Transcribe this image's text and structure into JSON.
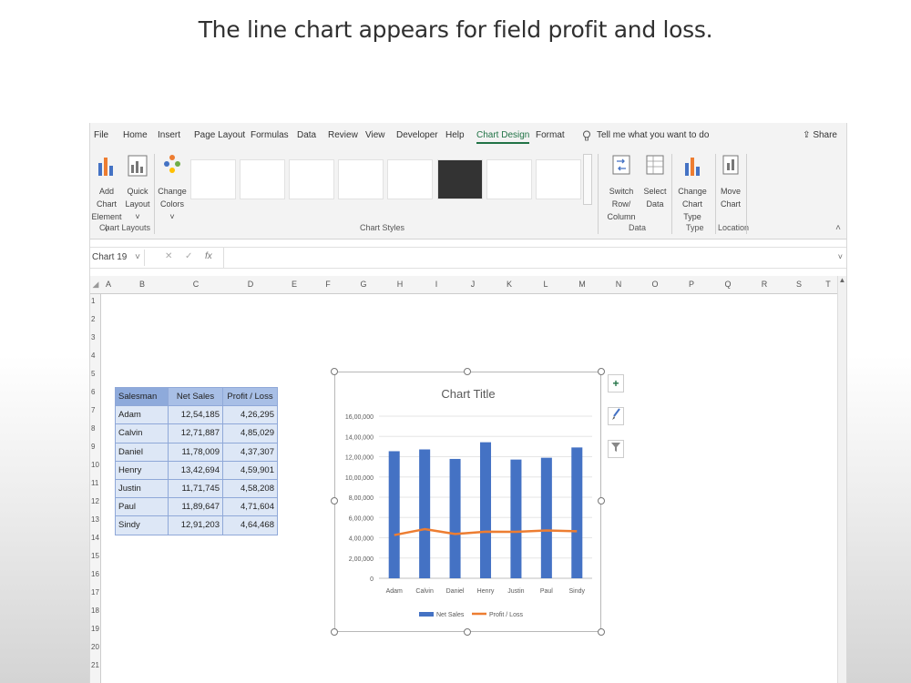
{
  "caption": "The line chart appears for field profit and loss.",
  "menu": {
    "tabs": [
      "File",
      "Home",
      "Insert",
      "Page Layout",
      "Formulas",
      "Data",
      "Review",
      "View",
      "Developer",
      "Help",
      "Chart Design",
      "Format"
    ],
    "active_tab": "Chart Design",
    "tell_me": "Tell me what you want to do",
    "share": "Share"
  },
  "ribbon": {
    "add_chart_element_1": "Add Chart",
    "add_chart_element_2": "Element ˅",
    "quick_layout_1": "Quick",
    "quick_layout_2": "Layout ˅",
    "chart_layouts_label": "Chart Layouts",
    "change_colors_1": "Change",
    "change_colors_2": "Colors ˅",
    "chart_styles_label": "Chart Styles",
    "switch_row_1": "Switch Row/",
    "switch_row_2": "Column",
    "select_data_1": "Select",
    "select_data_2": "Data",
    "data_label": "Data",
    "change_type_1": "Change",
    "change_type_2": "Chart Type",
    "type_label": "Type",
    "move_chart_1": "Move",
    "move_chart_2": "Chart",
    "location_label": "Location"
  },
  "formula_bar": {
    "name_box": "Chart 19",
    "fx": "fx"
  },
  "columns": [
    "A",
    "B",
    "C",
    "D",
    "E",
    "F",
    "G",
    "H",
    "I",
    "J",
    "K",
    "L",
    "M",
    "N",
    "O",
    "P",
    "Q",
    "R",
    "S",
    "T"
  ],
  "rows": [
    "1",
    "2",
    "3",
    "4",
    "5",
    "6",
    "7",
    "8",
    "9",
    "10",
    "11",
    "12",
    "13",
    "14",
    "15",
    "16",
    "17",
    "18",
    "19",
    "20",
    "21"
  ],
  "table": {
    "headers": [
      "Salesman",
      "Net Sales",
      "Profit / Loss"
    ],
    "rows": [
      [
        "Adam",
        "12,54,185",
        "4,26,295"
      ],
      [
        "Calvin",
        "12,71,887",
        "4,85,029"
      ],
      [
        "Daniel",
        "11,78,009",
        "4,37,307"
      ],
      [
        "Henry",
        "13,42,694",
        "4,59,901"
      ],
      [
        "Justin",
        "11,71,745",
        "4,58,208"
      ],
      [
        "Paul",
        "11,89,647",
        "4,71,604"
      ],
      [
        "Sindy",
        "12,91,203",
        "4,64,468"
      ]
    ]
  },
  "chart_data": {
    "type": "bar",
    "title": "Chart Title",
    "categories": [
      "Adam",
      "Calvin",
      "Daniel",
      "Henry",
      "Justin",
      "Paul",
      "Sindy"
    ],
    "series": [
      {
        "name": "Net Sales",
        "type": "bar",
        "color": "#4472c4",
        "values": [
          1254185,
          1271887,
          1178009,
          1342694,
          1171745,
          1189647,
          1291203
        ]
      },
      {
        "name": "Profit / Loss",
        "type": "line",
        "color": "#ed7d31",
        "values": [
          426295,
          485029,
          437307,
          459901,
          458208,
          471604,
          464468
        ]
      }
    ],
    "yticks": [
      "0",
      "2,00,000",
      "4,00,000",
      "6,00,000",
      "8,00,000",
      "10,00,000",
      "12,00,000",
      "14,00,000",
      "16,00,000"
    ],
    "ylim": [
      0,
      1600000
    ],
    "grid": true,
    "legend": "bottom"
  },
  "side_buttons": {
    "add": "+"
  }
}
